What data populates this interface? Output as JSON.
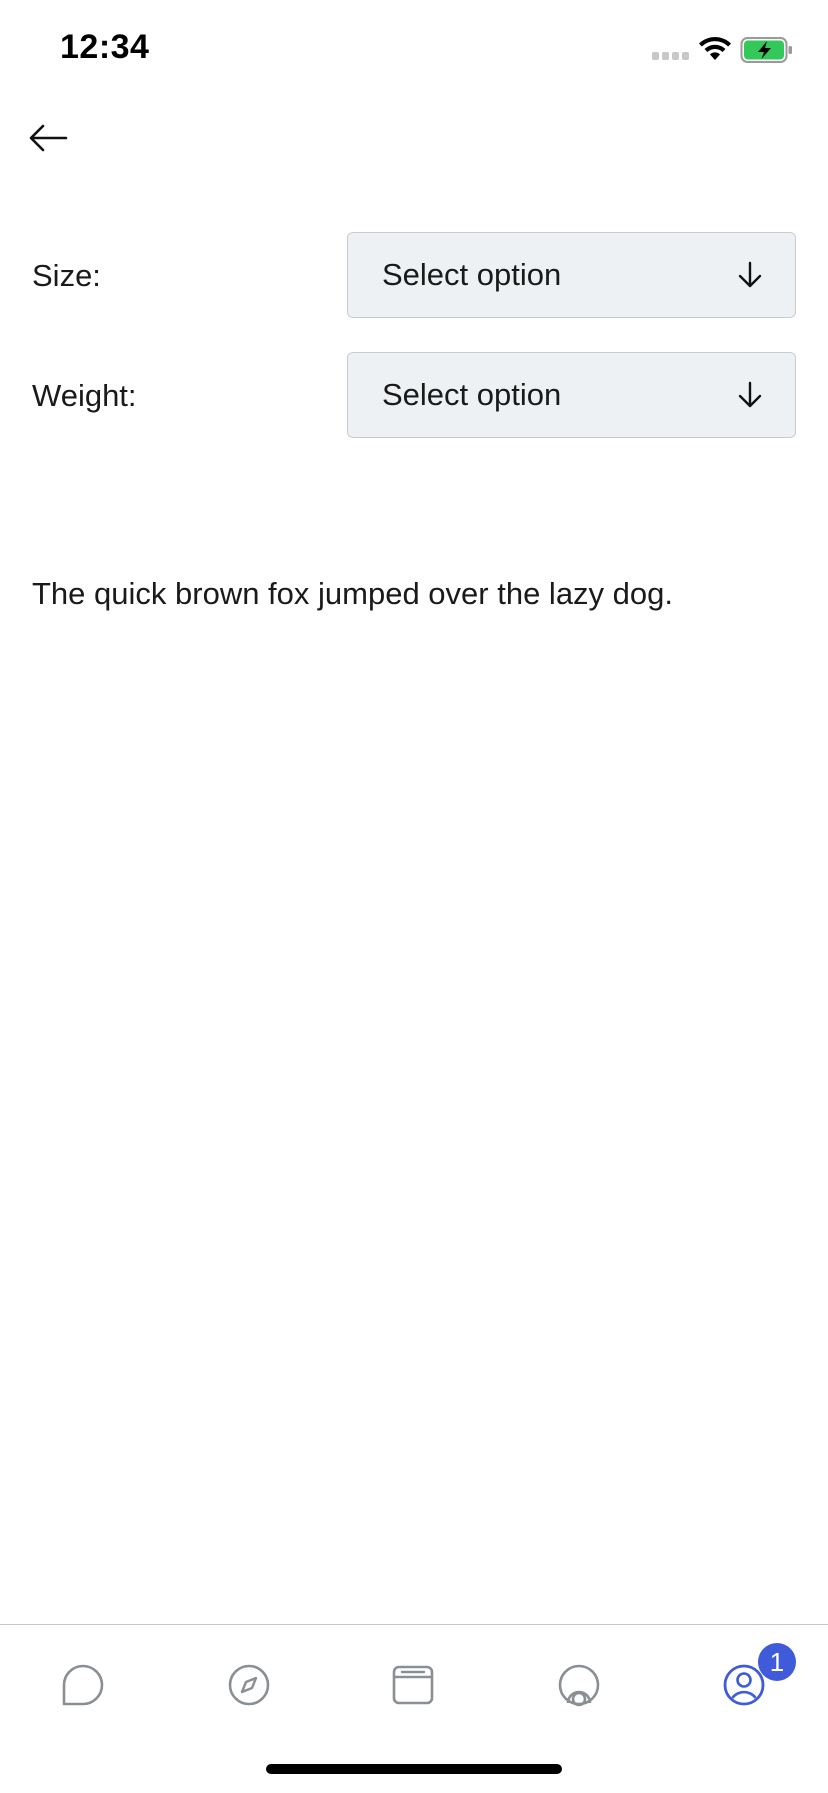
{
  "status_bar": {
    "time": "12:34",
    "wifi_icon": "wifi-icon",
    "battery_icon": "battery-charging-icon",
    "battery_color": "#34c759"
  },
  "header": {
    "back_icon": "arrow-left-icon"
  },
  "form": {
    "size": {
      "label": "Size:",
      "value": "Select option",
      "icon": "arrow-down-icon"
    },
    "weight": {
      "label": "Weight:",
      "value": "Select option",
      "icon": "arrow-down-icon"
    }
  },
  "content": {
    "text": "The quick brown fox jumped over the lazy dog."
  },
  "tab_bar": {
    "tabs": [
      {
        "icon": "chat-bubble-icon",
        "active": false
      },
      {
        "icon": "compass-icon",
        "active": false
      },
      {
        "icon": "browser-window-icon",
        "active": false
      },
      {
        "icon": "signal-icon",
        "active": false
      },
      {
        "icon": "profile-icon",
        "active": true
      }
    ],
    "badge_count": "1",
    "active_color": "#3f5bd9",
    "inactive_color": "#8a8f94"
  }
}
